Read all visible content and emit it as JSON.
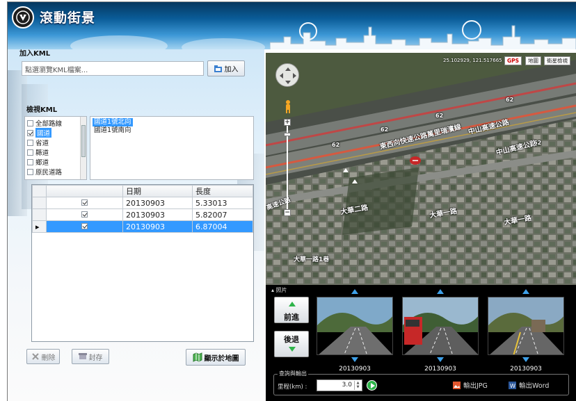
{
  "app": {
    "title": "滾動街景"
  },
  "add_kml": {
    "group_label": "加入KML",
    "file_placeholder": "點選瀏覽KML檔案...",
    "add_label": "加入"
  },
  "browse_kml": {
    "group_label": "檢視KML",
    "categories": [
      {
        "label": "全部路線",
        "checked": false,
        "selected": false
      },
      {
        "label": "國道",
        "checked": true,
        "selected": true
      },
      {
        "label": "省道",
        "checked": false,
        "selected": false
      },
      {
        "label": "縣道",
        "checked": false,
        "selected": false
      },
      {
        "label": "鄉道",
        "checked": false,
        "selected": false
      },
      {
        "label": "原民道路",
        "checked": false,
        "selected": false
      }
    ],
    "roads": [
      {
        "label": "國道1號北向",
        "selected": true
      },
      {
        "label": "國道1號南向",
        "selected": false
      }
    ]
  },
  "grid": {
    "columns": [
      "",
      "日期",
      "長度"
    ],
    "rows": [
      {
        "checked": true,
        "date": "20130903",
        "length": "5.33013",
        "selected": false
      },
      {
        "checked": true,
        "date": "20130903",
        "length": "5.82007",
        "selected": false
      },
      {
        "checked": true,
        "date": "20130903",
        "length": "6.87004",
        "selected": true
      }
    ]
  },
  "actions": {
    "delete_label": "刪除",
    "seal_label": "封存",
    "show_map_label": "顯示於地圖"
  },
  "map": {
    "coord_readout": "25.102929, 121.517665",
    "gps_label": "GPS",
    "map_label": "地圖",
    "satellite_label": "衛星檢視",
    "labels": {
      "expressway": "東西向快速公路萬里瑞濱線",
      "zhongshan_1": "中山高速公路",
      "zhongshan_2": "中山高速公路",
      "route_62_a": "62",
      "route_62_b": "62",
      "route_62_c": "62",
      "route_62_d": "62",
      "route_62_e": "62",
      "dahua_1": "大華二路",
      "dahua_2": "大華一路",
      "dahua_3": "大華一路",
      "dahua_4": "大華一路1巷",
      "speedway": "高速公路"
    }
  },
  "photos": {
    "panel_label": "照片",
    "forward_label": "前進",
    "back_label": "後退",
    "dates": [
      "20130903",
      "20130903",
      "20130903"
    ]
  },
  "export": {
    "group_label": "查詢與輸出",
    "mileage_label": "里程(km) :",
    "mileage_value": "3.0",
    "jpg_label": "輸出JPG",
    "word_label": "輸出Word"
  },
  "colors": {
    "selection": "#3399ff",
    "header": "#0a5c98",
    "go": "#2eb44a"
  }
}
